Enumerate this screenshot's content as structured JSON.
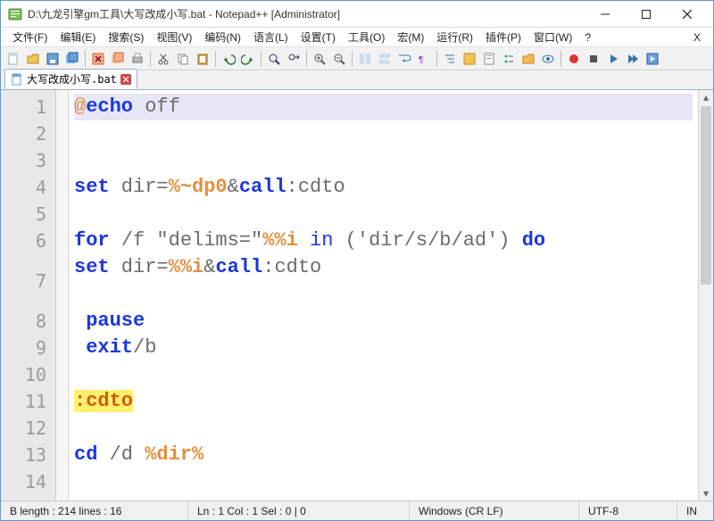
{
  "window": {
    "title": "D:\\九龙引擎gm工具\\大写改成小写.bat - Notepad++ [Administrator]"
  },
  "menu": {
    "file": "文件(F)",
    "edit": "编辑(E)",
    "search": "搜索(S)",
    "view": "视图(V)",
    "encoding": "编码(N)",
    "language": "语言(L)",
    "settings": "设置(T)",
    "tools": "工具(O)",
    "macro": "宏(M)",
    "run": "运行(R)",
    "plugins": "插件(P)",
    "window": "窗口(W)",
    "help": "?"
  },
  "tab": {
    "label": "大写改成小写.bat"
  },
  "gutter": [
    "1",
    "2",
    "3",
    "4",
    "5",
    "6",
    "7",
    "8",
    "9",
    "10",
    "11",
    "12",
    "13",
    "14"
  ],
  "code": {
    "l1_at": "@",
    "l1_kw": "echo",
    "l1_rest": " off",
    "l4_kw": "set",
    "l4_txt": " dir",
    "l4_eq": "=",
    "l4_var": "%~dp0",
    "l4_amp": "&",
    "l4_kw2": "call",
    "l4_lbl": ":cdto",
    "l6_kw": "for",
    "l6_sw": " /f ",
    "l6_q": "\"delims=\"",
    "l6_var": "%%i",
    "l6_in": " in ",
    "l6_paren": "('dir",
    "l6_args": "/s/b/ad') ",
    "l6_do": "do ",
    "l6b_kw": "set",
    "l6b_txt": " dir",
    "l6b_eq": "=",
    "l6b_var": "%%i",
    "l6b_amp": "&",
    "l6b_kw2": "call",
    "l6b_lbl": ":cdto",
    "l8_kw": " pause",
    "l9_kw": " exit",
    "l9_sw": "/b",
    "l11_lbl": ":cdto",
    "l13_kw": "cd",
    "l13_sw": " /d ",
    "l13_var": "%dir%"
  },
  "status": {
    "length": "B length : 214    lines : 16",
    "pos": "Ln : 1    Col : 1    Sel : 0 | 0",
    "eol": "Windows (CR LF)",
    "enc": "UTF-8",
    "ins": "IN"
  },
  "colors": {
    "accent": "#6699cc"
  }
}
